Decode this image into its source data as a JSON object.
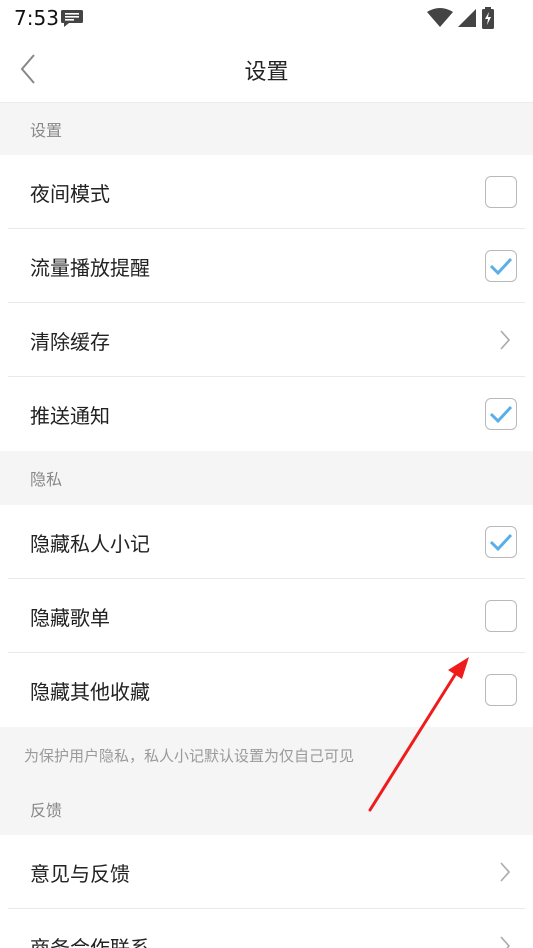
{
  "status_bar": {
    "time": "7:53",
    "icons": [
      "message-icon",
      "wifi-icon",
      "signal-icon",
      "battery-charging-icon"
    ]
  },
  "nav": {
    "title": "设置",
    "back_icon": "chevron-left-icon"
  },
  "sections": [
    {
      "header": "设置",
      "rows": [
        {
          "label": "夜间模式",
          "control": "checkbox",
          "checked": false
        },
        {
          "label": "流量播放提醒",
          "control": "checkbox",
          "checked": true
        },
        {
          "label": "清除缓存",
          "control": "chevron"
        },
        {
          "label": "推送通知",
          "control": "checkbox",
          "checked": true
        }
      ]
    },
    {
      "header": "隐私",
      "rows": [
        {
          "label": "隐藏私人小记",
          "control": "checkbox",
          "checked": true
        },
        {
          "label": "隐藏歌单",
          "control": "checkbox",
          "checked": false
        },
        {
          "label": "隐藏其他收藏",
          "control": "checkbox",
          "checked": false
        }
      ],
      "note": "为保护用户隐私，私人小记默认设置为仅自己可见"
    },
    {
      "header": "反馈",
      "rows": [
        {
          "label": "意见与反馈",
          "control": "chevron"
        },
        {
          "label": "商务合作联系",
          "control": "chevron"
        }
      ]
    }
  ],
  "colors": {
    "check_blue": "#5aafe6",
    "annotation_red": "#ee1c1c"
  }
}
